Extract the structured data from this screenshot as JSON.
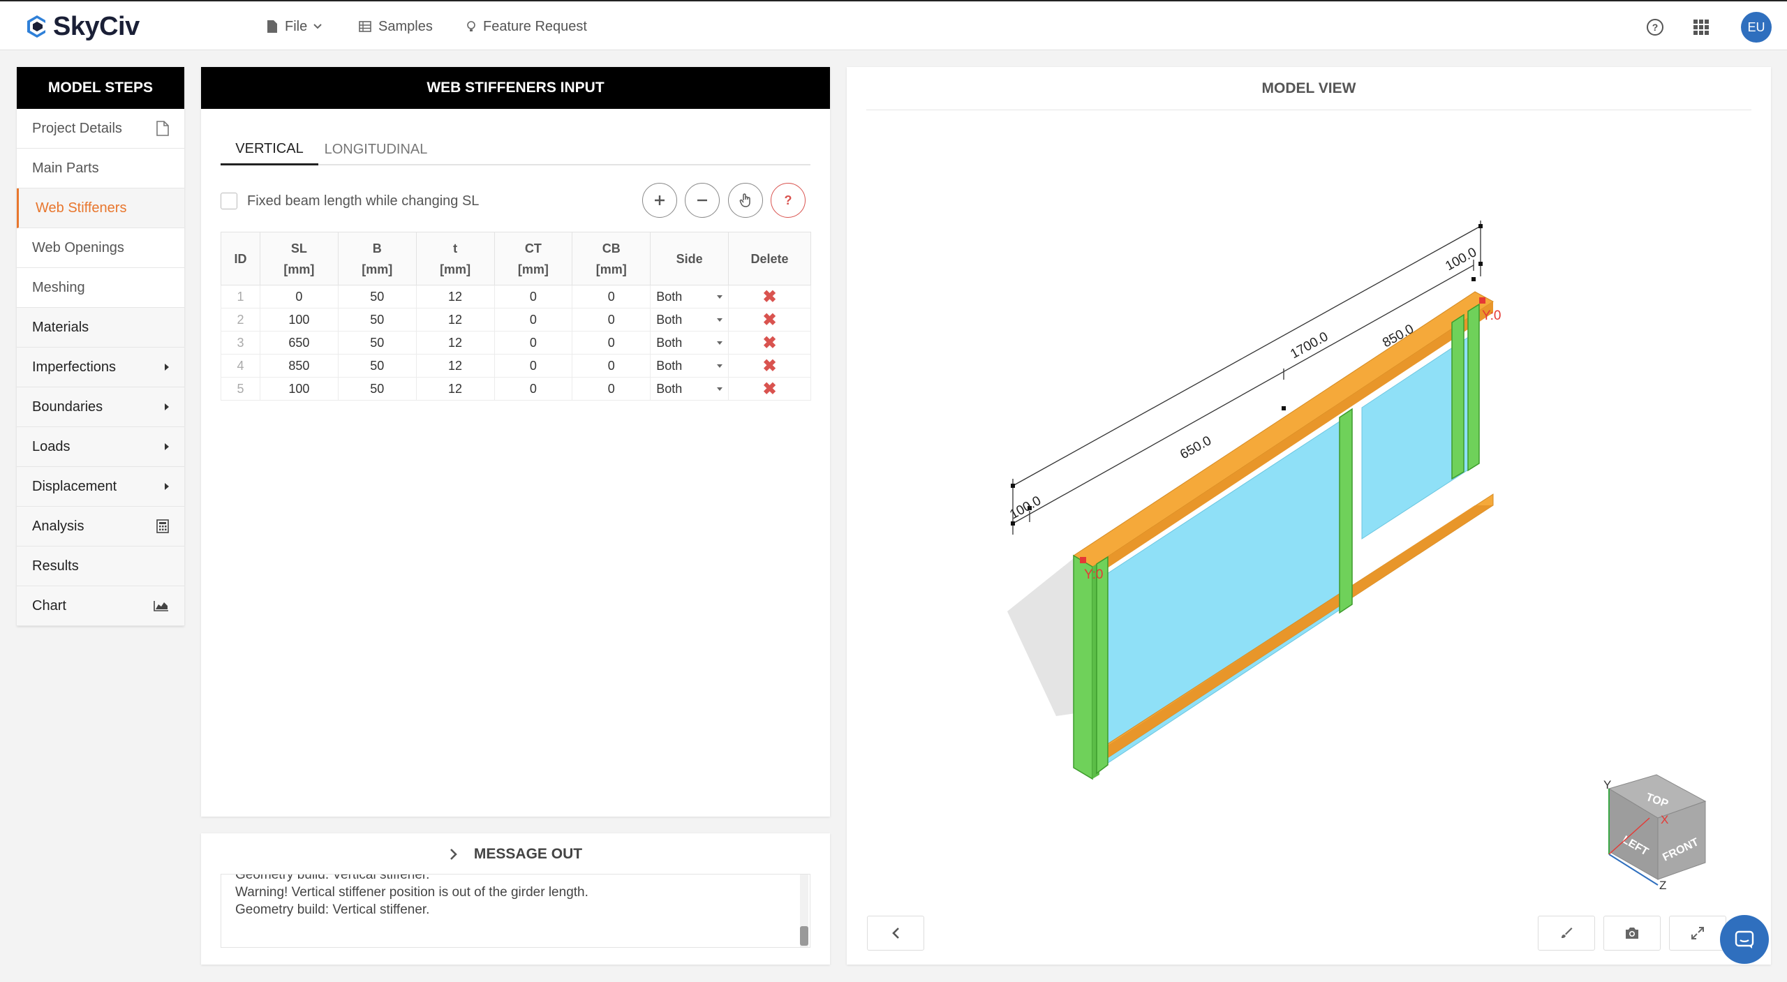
{
  "app": {
    "logo_text": "SkyCiv",
    "user_initials": "EU"
  },
  "topnav": {
    "file": "File",
    "samples": "Samples",
    "feature_request": "Feature Request"
  },
  "steps": {
    "title": "MODEL STEPS",
    "items": [
      {
        "label": "Project Details",
        "icon": "document-icon"
      },
      {
        "label": "Main Parts"
      },
      {
        "label": "Web Stiffeners",
        "active": true
      },
      {
        "label": "Web Openings"
      },
      {
        "label": "Meshing"
      },
      {
        "label": "Materials"
      },
      {
        "label": "Imperfections",
        "icon": "caret-right-icon"
      },
      {
        "label": "Boundaries",
        "icon": "caret-right-icon"
      },
      {
        "label": "Loads",
        "icon": "caret-right-icon"
      },
      {
        "label": "Displacement",
        "icon": "caret-right-icon"
      },
      {
        "label": "Analysis",
        "icon": "calculator-icon"
      },
      {
        "label": "Results"
      },
      {
        "label": "Chart",
        "icon": "area-chart-icon"
      }
    ]
  },
  "input": {
    "title": "WEB STIFFENERS INPUT",
    "tabs": [
      "VERTICAL",
      "LONGITUDINAL"
    ],
    "fixed_length_label": "Fixed beam length while changing SL",
    "help_label": "?",
    "columns": {
      "id": "ID",
      "sl": "SL",
      "sl_unit": "[mm]",
      "b": "B",
      "b_unit": "[mm]",
      "t": "t",
      "t_unit": "[mm]",
      "ct": "CT",
      "ct_unit": "[mm]",
      "cb": "CB",
      "cb_unit": "[mm]",
      "side": "Side",
      "delete": "Delete"
    },
    "rows": [
      {
        "id": "1",
        "sl": "0",
        "b": "50",
        "t": "12",
        "ct": "0",
        "cb": "0",
        "side": "Both"
      },
      {
        "id": "2",
        "sl": "100",
        "b": "50",
        "t": "12",
        "ct": "0",
        "cb": "0",
        "side": "Both"
      },
      {
        "id": "3",
        "sl": "650",
        "b": "50",
        "t": "12",
        "ct": "0",
        "cb": "0",
        "side": "Both"
      },
      {
        "id": "4",
        "sl": "850",
        "b": "50",
        "t": "12",
        "ct": "0",
        "cb": "0",
        "side": "Both"
      },
      {
        "id": "5",
        "sl": "100",
        "b": "50",
        "t": "12",
        "ct": "0",
        "cb": "0",
        "side": "Both"
      }
    ]
  },
  "messages": {
    "title": "MESSAGE OUT",
    "lines": [
      "Geometry build: Vertical stiffener.",
      "Warning! Vertical stiffener position is out of the girder length.",
      "Geometry build: Vertical stiffener."
    ]
  },
  "model_view": {
    "title": "MODEL VIEW",
    "dims": {
      "d1": "100.0",
      "d2": "650.0",
      "d3": "1700.0",
      "d4": "850.0",
      "d5": "100.0"
    },
    "support_labels": [
      "Y:0",
      "Y:0"
    ],
    "cube": {
      "top": "TOP",
      "left": "LEFT",
      "front": "FRONT",
      "axis_y": "Y",
      "axis_x": "X",
      "axis_z": "Z"
    },
    "colors": {
      "flange": "#f5a93a",
      "stiffener": "#6fd15a",
      "web": "#8fe0f7"
    }
  }
}
